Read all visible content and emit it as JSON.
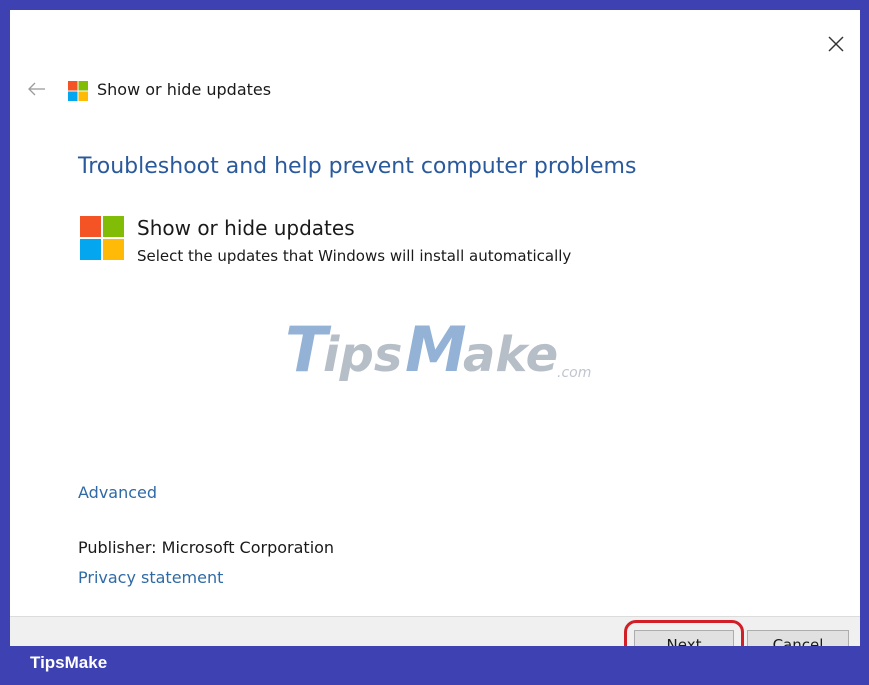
{
  "window": {
    "header_title": "Show or hide updates",
    "close_icon": "close-icon",
    "back_icon": "back-arrow-icon"
  },
  "main": {
    "heading": "Troubleshoot and help prevent computer problems",
    "app_name": "Show or hide updates",
    "app_description": "Select the updates that Windows will install automatically",
    "app_icon": "windows-logo-icon"
  },
  "links": {
    "advanced": "Advanced",
    "privacy": "Privacy statement"
  },
  "publisher": {
    "text": "Publisher:  Microsoft Corporation"
  },
  "footer": {
    "next_label": "Next",
    "cancel_label": "Cancel"
  },
  "watermark": {
    "brand": "TipsMake",
    "suffix": ".com"
  },
  "banner": {
    "text": "TipsMake"
  },
  "colors": {
    "heading_blue": "#2a5a9c",
    "link_blue": "#2f6aa6",
    "banner_bg": "#3d41b2",
    "highlight_red": "#d21e26",
    "win_red": "#f35325",
    "win_green": "#81bc06",
    "win_blue": "#05a6f0",
    "win_yellow": "#ffba08"
  }
}
